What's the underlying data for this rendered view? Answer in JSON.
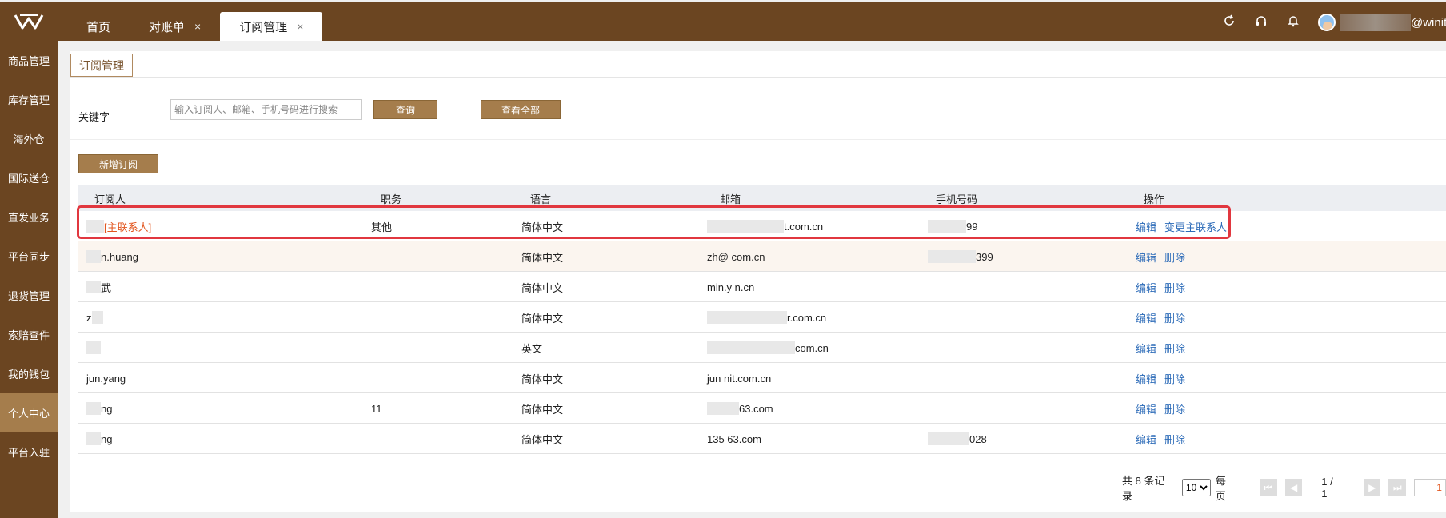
{
  "topbar": {
    "tabs": [
      {
        "label": "首页",
        "closable": false,
        "active": false
      },
      {
        "label": "对账单",
        "closable": true,
        "active": false
      },
      {
        "label": "订阅管理",
        "closable": true,
        "active": true
      }
    ],
    "close_glyph": "×",
    "user_suffix": "@winit.c"
  },
  "sidebar": {
    "items": [
      "商品管理",
      "库存管理",
      "海外仓",
      "国际送仓",
      "直发业务",
      "平台同步",
      "退货管理",
      "索赔查件",
      "我的钱包",
      "个人中心",
      "平台入驻"
    ],
    "active_index": 9
  },
  "page": {
    "tab_label": "订阅管理",
    "search": {
      "label": "关键字",
      "placeholder": "输入订阅人、邮箱、手机号码进行搜索",
      "query_button": "查询",
      "view_all_button": "查看全部"
    },
    "add_button": "新增订阅"
  },
  "table": {
    "headers": [
      "订阅人",
      "职务",
      "语言",
      "邮箱",
      "手机号码",
      "操作"
    ],
    "rows": [
      {
        "name": "",
        "tag": "[主联系人]",
        "position": "其他",
        "language": "简体中文",
        "email": "t.com.cn",
        "phone": "99",
        "actions": [
          "编辑",
          "变更主联系人"
        ]
      },
      {
        "name": "n.huang",
        "tag": "",
        "position": "",
        "language": "简体中文",
        "email": "zh@ com.cn",
        "phone": "399",
        "actions": [
          "编辑",
          "删除"
        ]
      },
      {
        "name": "武",
        "tag": "",
        "position": "",
        "language": "简体中文",
        "email": "min.y n.cn",
        "phone": "",
        "actions": [
          "编辑",
          "删除"
        ]
      },
      {
        "name": "z",
        "tag": "",
        "position": "",
        "language": "简体中文",
        "email": "r.com.cn",
        "phone": "",
        "actions": [
          "编辑",
          "删除"
        ]
      },
      {
        "name": "",
        "tag": "",
        "position": "",
        "language": "英文",
        "email": "com.cn",
        "phone": "",
        "actions": [
          "编辑",
          "删除"
        ]
      },
      {
        "name": "jun.yang",
        "tag": "",
        "position": "",
        "language": "简体中文",
        "email": "jun nit.com.cn",
        "phone": "",
        "actions": [
          "编辑",
          "删除"
        ]
      },
      {
        "name": "ng",
        "tag": "",
        "position": "11",
        "language": "简体中文",
        "email": "63.com",
        "phone": "",
        "actions": [
          "编辑",
          "删除"
        ]
      },
      {
        "name": "ng",
        "tag": "",
        "position": "",
        "language": "简体中文",
        "email": "135 63.com",
        "phone": "028",
        "actions": [
          "编辑",
          "删除"
        ]
      }
    ]
  },
  "pagination": {
    "total_text": "共 8 条记录",
    "page_size": "10",
    "per_page_label": "每页",
    "page_info": "1 / 1",
    "current_page": "1"
  },
  "colors": {
    "brand_brown": "#6b4521",
    "button_brown": "#a57d4c",
    "highlight_red": "#e1373f",
    "link_blue": "#2c6bb8",
    "tag_orange": "#e2561f"
  }
}
